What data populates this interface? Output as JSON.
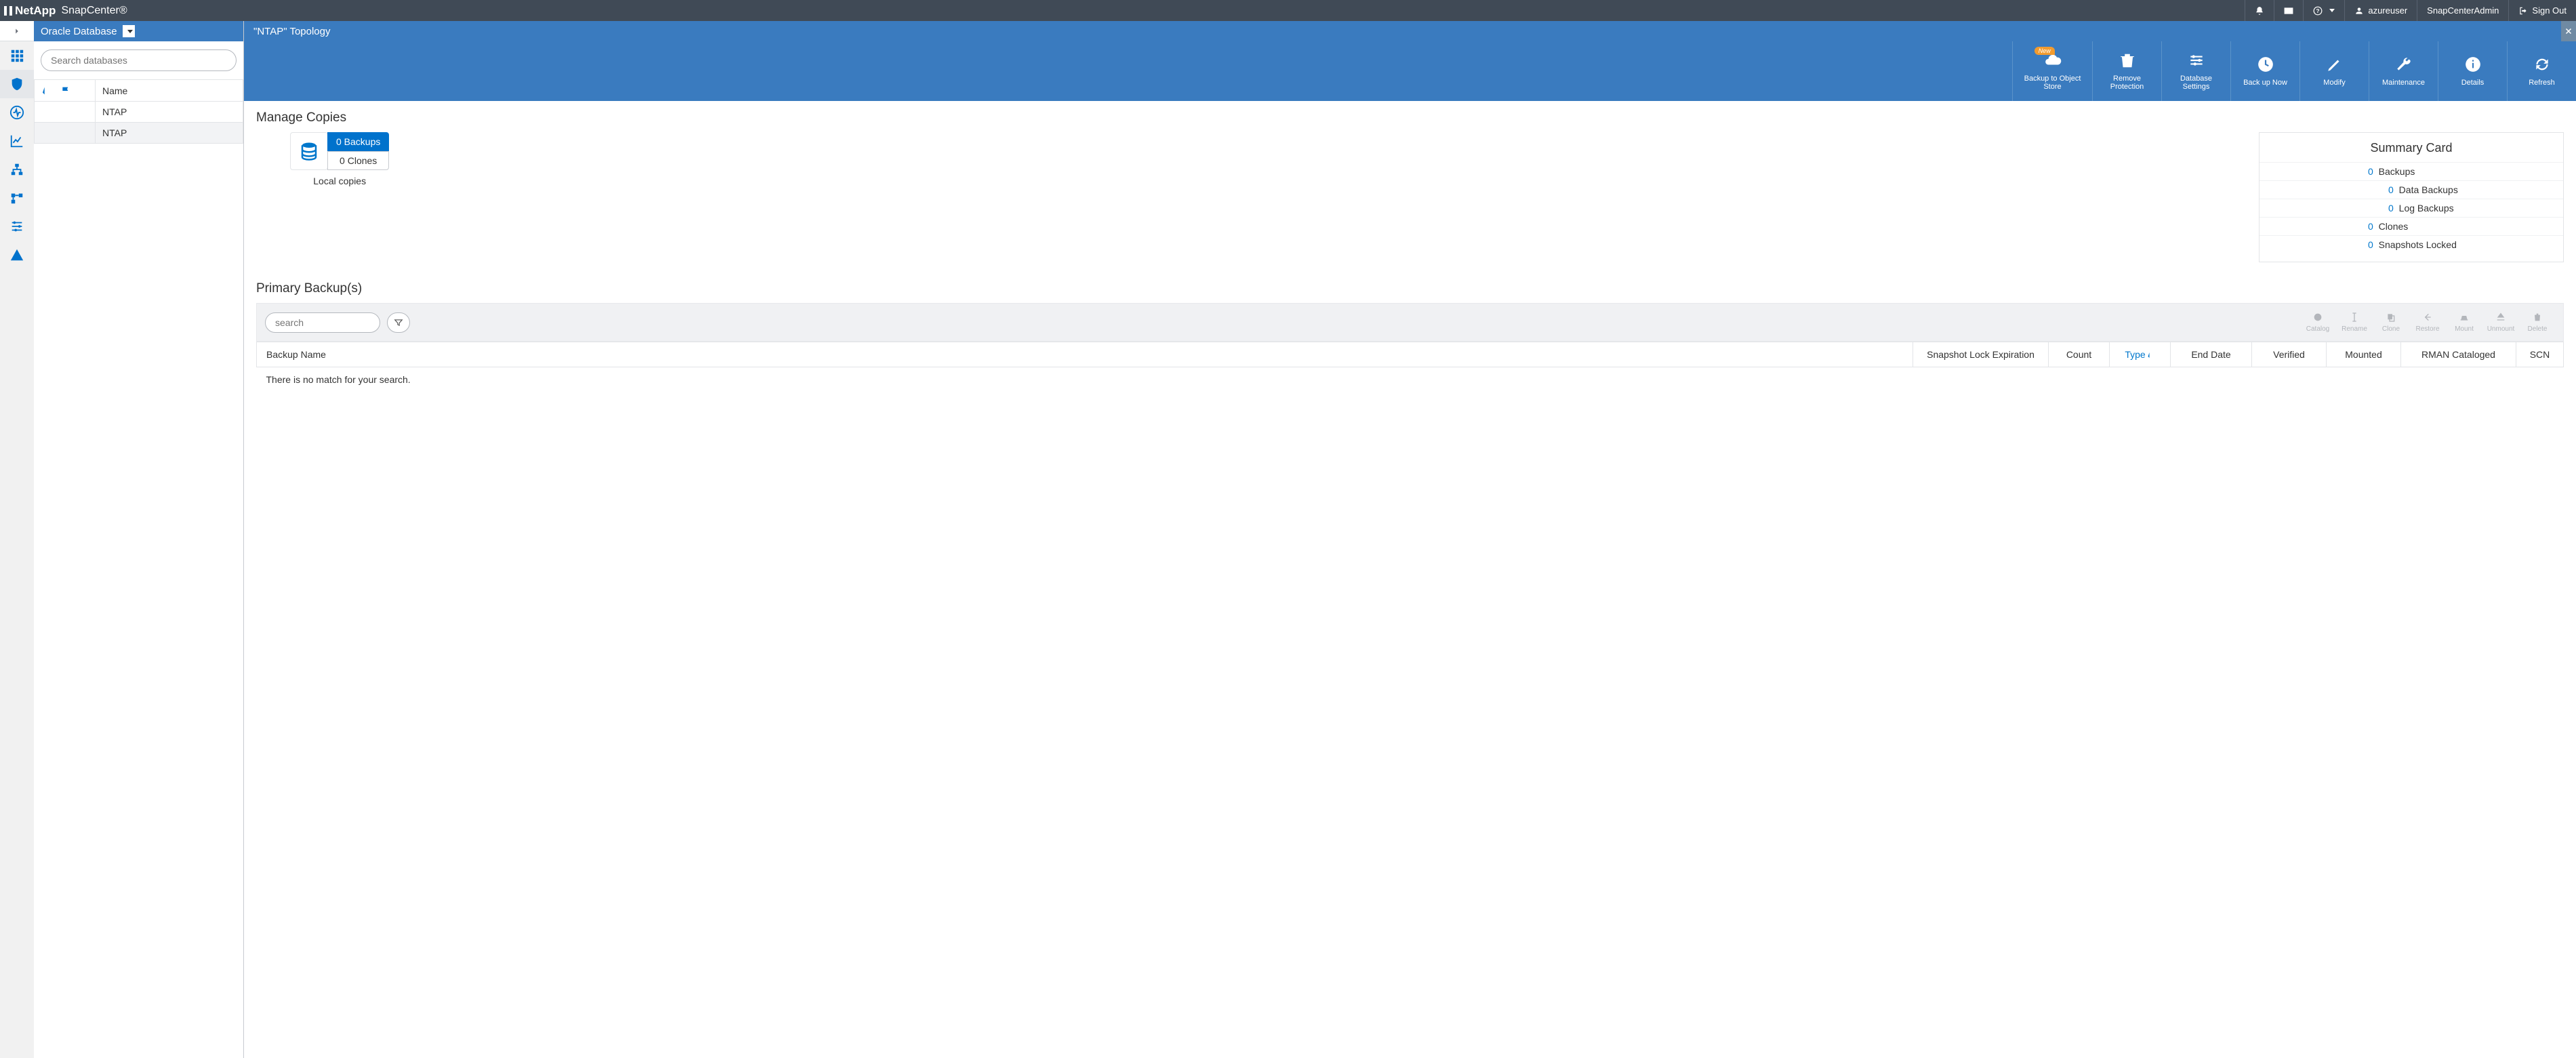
{
  "navbar": {
    "brand": "NetApp",
    "product": "SnapCenter®",
    "user": "azureuser",
    "role": "SnapCenterAdmin",
    "signout": "Sign Out"
  },
  "sidepanel": {
    "title": "Oracle Database",
    "search_placeholder": "Search databases",
    "name_header": "Name",
    "rows": [
      "NTAP",
      "NTAP"
    ]
  },
  "main": {
    "title": "\"NTAP\" Topology"
  },
  "toolbar": {
    "backup_obj": "Backup to Object Store",
    "remove_protection": "Remove Protection",
    "db_settings": "Database Settings",
    "backup_now": "Back up Now",
    "modify": "Modify",
    "maintenance": "Maintenance",
    "details": "Details",
    "refresh": "Refresh",
    "new_badge": "New"
  },
  "manage_copies": {
    "title": "Manage Copies",
    "backups": "0 Backups",
    "clones": "0 Clones",
    "local_label": "Local copies"
  },
  "summary": {
    "title": "Summary Card",
    "items": [
      {
        "count": "0",
        "label": "Backups",
        "indent": false
      },
      {
        "count": "0",
        "label": "Data Backups",
        "indent": true
      },
      {
        "count": "0",
        "label": "Log Backups",
        "indent": true
      },
      {
        "count": "0",
        "label": "Clones",
        "indent": false
      },
      {
        "count": "0",
        "label": "Snapshots Locked",
        "indent": false
      }
    ]
  },
  "primary": {
    "title": "Primary Backup(s)",
    "search_placeholder": "search",
    "actions": [
      "Catalog",
      "Rename",
      "Clone",
      "Restore",
      "Mount",
      "Unmount",
      "Delete"
    ],
    "columns": [
      "Backup Name",
      "Snapshot Lock Expiration",
      "Count",
      "Type",
      "End Date",
      "Verified",
      "Mounted",
      "RMAN Cataloged",
      "SCN"
    ],
    "sorted_col": "Type",
    "no_match": "There is no match for your search."
  }
}
